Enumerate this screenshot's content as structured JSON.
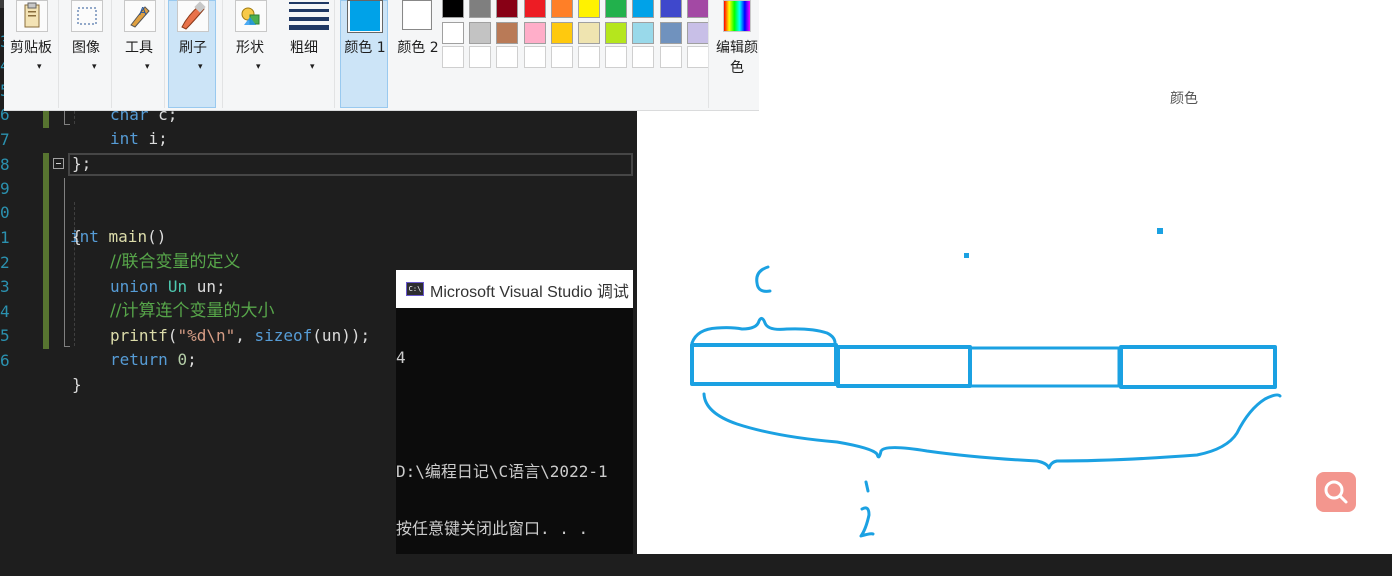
{
  "editor": {
    "lines": [
      {
        "num": "3"
      },
      {
        "num": "4"
      },
      {
        "num": "5"
      },
      {
        "num": "6"
      },
      {
        "num": "7"
      },
      {
        "num": "8"
      },
      {
        "num": "9"
      },
      {
        "num": "0"
      },
      {
        "num": "1"
      },
      {
        "num": "2"
      },
      {
        "num": "3"
      },
      {
        "num": "4"
      },
      {
        "num": "5"
      },
      {
        "num": "6"
      }
    ],
    "kw_union": "union",
    "id_Un": "Un",
    "brace_open": "{",
    "brace_close_semi": "};",
    "brace_close": "}",
    "kw_char": "char",
    "decl_c": " c;",
    "kw_int": "int",
    "decl_i": " i;",
    "fn_main": " main",
    "parens": "()",
    "comment1": "//联合变量的定义",
    "decl_un": " un;",
    "comment2": "//计算连个变量的大小",
    "fn_printf": "printf",
    "paren_open": "(",
    "str_fmt": "\"%d\\n\"",
    "comma": ", ",
    "kw_sizeof": "sizeof",
    "arg_un": "(un));",
    "kw_return": "return",
    "num_zero": "0",
    "semi": ";"
  },
  "console": {
    "title": "Microsoft Visual Studio 调试",
    "icon_text": "C:\\",
    "output": [
      "4",
      "",
      "D:\\编程日记\\C语言\\2022-1",
      "按任意键关闭此窗口. . ."
    ]
  },
  "paint": {
    "ribbon": {
      "clipboard": "剪贴板",
      "image": "图像",
      "tools": "工具",
      "brushes": "刷子",
      "shapes": "形状",
      "size": "粗细",
      "color1": "颜色 1",
      "color2": "颜色 2",
      "edit_colors": "编辑颜色",
      "colors_group": "颜色"
    },
    "color1_hex": "#00a2e8",
    "color2_hex": "#ffffff",
    "palette_row1": [
      "#000000",
      "#7f7f7f",
      "#880015",
      "#ed1c24",
      "#ff7f27",
      "#fff200",
      "#22b14c",
      "#00a2e8",
      "#3f48cc",
      "#a349a4"
    ],
    "palette_row2": [
      "#ffffff",
      "#c3c3c3",
      "#b97a57",
      "#ffaec9",
      "#ffc90e",
      "#efe4b0",
      "#b5e61d",
      "#99d9ea",
      "#7092be",
      "#c8bfe7"
    ],
    "ink_color": "#1ba1e2"
  }
}
